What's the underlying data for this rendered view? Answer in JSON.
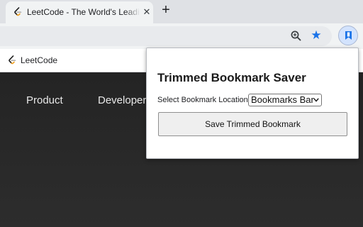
{
  "tab": {
    "title": "LeetCode - The World's Leading",
    "close_glyph": "✕"
  },
  "newtab": {
    "glyph": "+"
  },
  "toolbar": {
    "star_glyph": "★",
    "accent_color": "#1a73e8"
  },
  "bookmarks_bar": {
    "items": [
      {
        "label": "LeetCode",
        "icon": "leetcode-icon"
      }
    ]
  },
  "page": {
    "nav": [
      {
        "label": "Product"
      },
      {
        "label": "Developer"
      }
    ]
  },
  "popup": {
    "title": "Trimmed Bookmark Saver",
    "location_label": "Select Bookmark Location:",
    "location_selected": "Bookmarks Bar",
    "save_button_label": "Save Trimmed Bookmark"
  }
}
